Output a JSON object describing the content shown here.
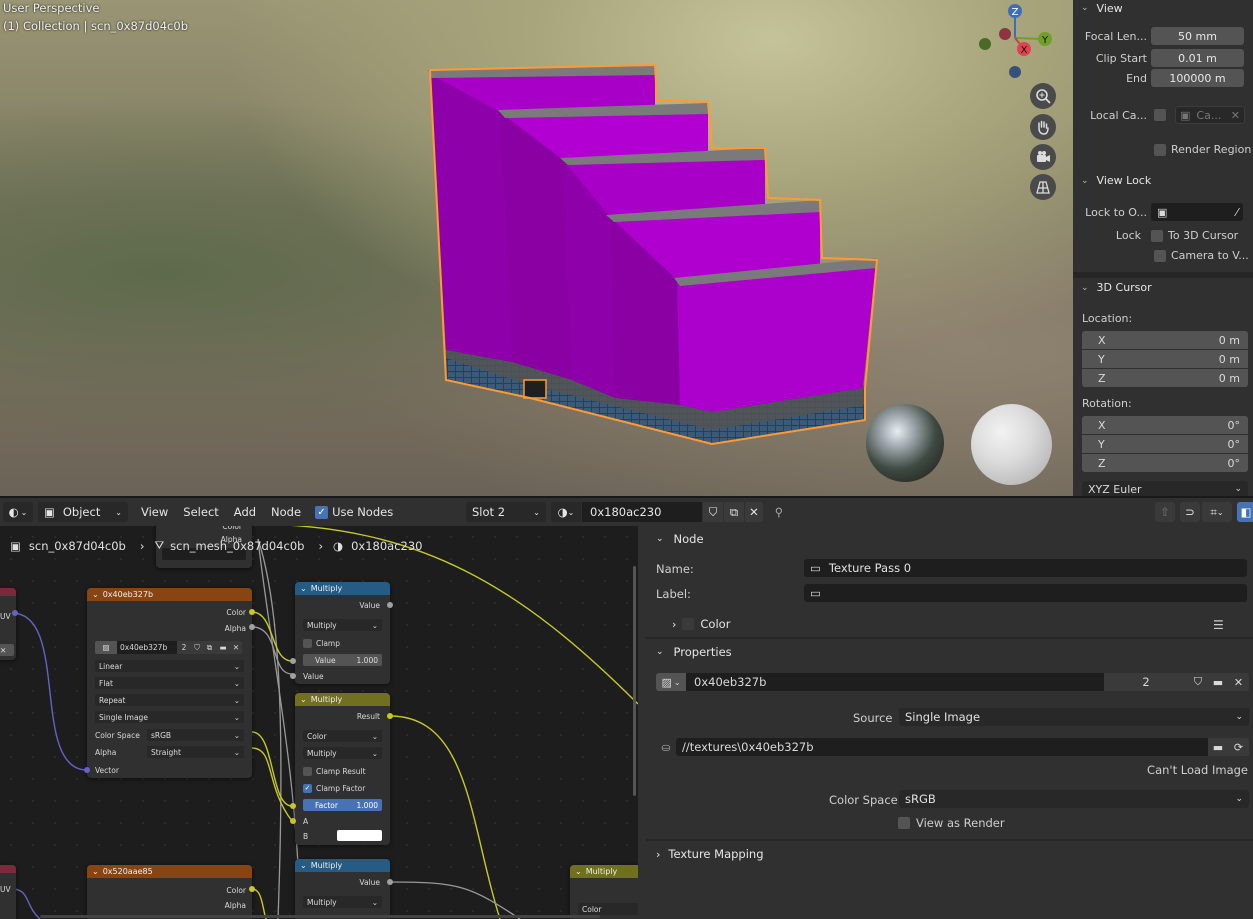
{
  "viewport": {
    "title": "User Perspective",
    "collection": "(1) Collection | scn_0x87d04c0b",
    "gizmo": {
      "z": "Z",
      "y": "Y",
      "x": "X"
    }
  },
  "view_panel": {
    "view_header": "View",
    "focal_label": "Focal Len...",
    "focal_value": "50 mm",
    "clip_start_label": "Clip Start",
    "clip_start_value": "0.01 m",
    "end_label": "End",
    "end_value": "100000 m",
    "local_cam_label": "Local Ca...",
    "local_cam_value": "Ca...",
    "render_region": "Render Region",
    "view_lock_header": "View Lock",
    "lock_obj_label": "Lock to O...",
    "lock_label": "Lock",
    "to_cursor": "To 3D Cursor",
    "camera_to_view": "Camera to V...",
    "cursor_header": "3D Cursor",
    "location_label": "Location:",
    "loc_x_label": "X",
    "loc_x": "0 m",
    "loc_y_label": "Y",
    "loc_y": "0 m",
    "loc_z_label": "Z",
    "loc_z": "0 m",
    "rotation_label": "Rotation:",
    "rot_x_label": "X",
    "rot_x": "0°",
    "rot_y_label": "Y",
    "rot_y": "0°",
    "rot_z_label": "Z",
    "rot_z": "0°",
    "rotation_mode": "XYZ Euler"
  },
  "node_header": {
    "mode": "Object",
    "menu": [
      "View",
      "Select",
      "Add",
      "Node"
    ],
    "use_nodes": "Use Nodes",
    "slot": "Slot 2",
    "material": "0x180ac230"
  },
  "breadcrumb": {
    "scene": "scn_0x87d04c0b",
    "mesh": "scn_mesh_0x87d04c0b",
    "material": "0x180ac230"
  },
  "nodes": {
    "top_stub": {
      "color": "Color",
      "alpha": "Alpha"
    },
    "uv_socket": "UV",
    "tex1": {
      "title": "0x40eb327b",
      "out_color": "Color",
      "out_alpha": "Alpha",
      "image": "0x40eb327b",
      "users": "2",
      "interp": "Linear",
      "proj": "Flat",
      "ext": "Repeat",
      "source": "Single Image",
      "cs_label": "Color Space",
      "cs": "sRGB",
      "alpha_label": "Alpha",
      "alpha": "Straight",
      "vector": "Vector"
    },
    "math1": {
      "title": "Multiply",
      "out": "Value",
      "op": "Multiply",
      "clamp": "Clamp",
      "value_label": "Value",
      "value": "1.000",
      "in": "Value"
    },
    "mix": {
      "title": "Multiply",
      "out": "Result",
      "type": "Color",
      "op": "Multiply",
      "clamp_result": "Clamp Result",
      "clamp_factor": "Clamp Factor",
      "factor_label": "Factor",
      "factor": "1.000",
      "a": "A",
      "b": "B"
    },
    "tex2": {
      "title": "0x520aae85",
      "out_color": "Color",
      "out_alpha": "Alpha"
    },
    "math2": {
      "title": "Multiply",
      "out": "Value",
      "op": "Multiply"
    },
    "mix2": {
      "title": "Multiply",
      "type": "Color"
    }
  },
  "props": {
    "node_header": "Node",
    "name_label": "Name:",
    "name_value": "Texture Pass 0",
    "label_label": "Label:",
    "label_value": "",
    "color_label": "Color",
    "properties_header": "Properties",
    "image": "0x40eb327b",
    "users": "2",
    "source_label": "Source",
    "source": "Single Image",
    "path": "//textures\\0x40eb327b",
    "cant_load": "Can't Load Image",
    "cs_label": "Color Space",
    "cs": "sRGB",
    "view_as_render": "View as Render",
    "texture_mapping": "Texture Mapping"
  },
  "colors": {
    "building": "#a900c7",
    "outline": "#ff9a33",
    "accent": "#4772b3",
    "texture_node": "#874514",
    "math_node": "#245c85",
    "mix_node": "#707020"
  }
}
